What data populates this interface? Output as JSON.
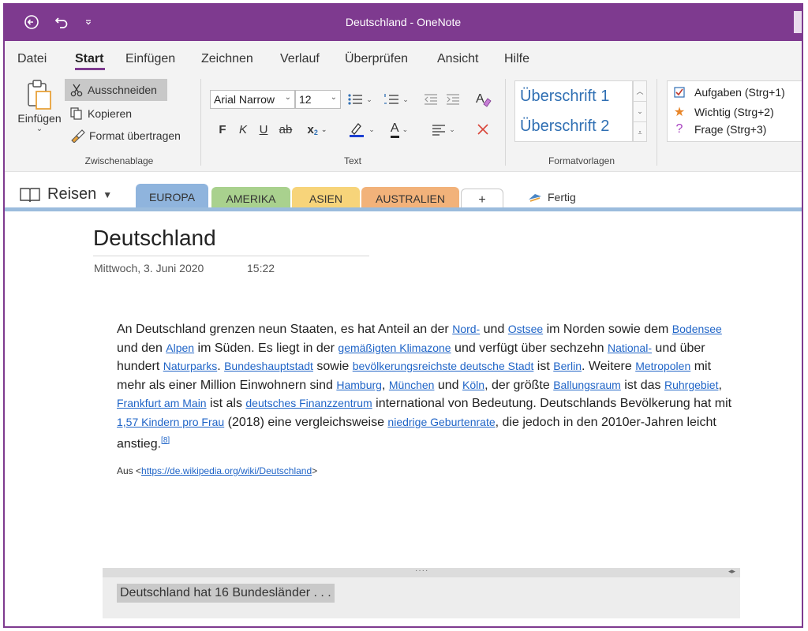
{
  "window": {
    "title": "Deutschland - OneNote",
    "accent": "#7e3a8f"
  },
  "menu": {
    "items": [
      "Datei",
      "Start",
      "Einfügen",
      "Zeichnen",
      "Verlauf",
      "Überprüfen",
      "Ansicht",
      "Hilfe"
    ],
    "active": "Start"
  },
  "ribbon": {
    "clipboard": {
      "paste": "Einfügen",
      "cut": "Ausschneiden",
      "copy": "Kopieren",
      "format_painter": "Format übertragen",
      "group_label": "Zwischenablage"
    },
    "text": {
      "font": "Arial Narrow",
      "size": "12",
      "bold": "F",
      "italic": "K",
      "underline": "U",
      "strike": "ab",
      "subscript": "x",
      "font_color": "A",
      "group_label": "Text"
    },
    "styles": {
      "items": [
        "Überschrift 1",
        "Überschrift 2"
      ],
      "group_label": "Formatvorlagen"
    },
    "tags": {
      "items": [
        "Aufgaben (Strg+1)",
        "Wichtig (Strg+2)",
        "Frage (Strg+3)"
      ]
    }
  },
  "notebook": {
    "name": "Reisen",
    "sections": [
      {
        "label": "EUROPA",
        "color": "#8fb4dd"
      },
      {
        "label": "AMERIKA",
        "color": "#a9d18e"
      },
      {
        "label": "ASIEN",
        "color": "#f7d47a"
      },
      {
        "label": "AUSTRALIEN",
        "color": "#f2b27a"
      }
    ],
    "add_label": "+",
    "status": "Fertig"
  },
  "page": {
    "title": "Deutschland",
    "date": "Mittwoch, 3. Juni 2020",
    "time": "15:22",
    "source_prefix": "Aus <",
    "source_url": "https://de.wikipedia.org/wiki/Deutschland",
    "source_suffix": ">",
    "container_text": "Deutschland hat 16 Bundesländer . . ."
  }
}
